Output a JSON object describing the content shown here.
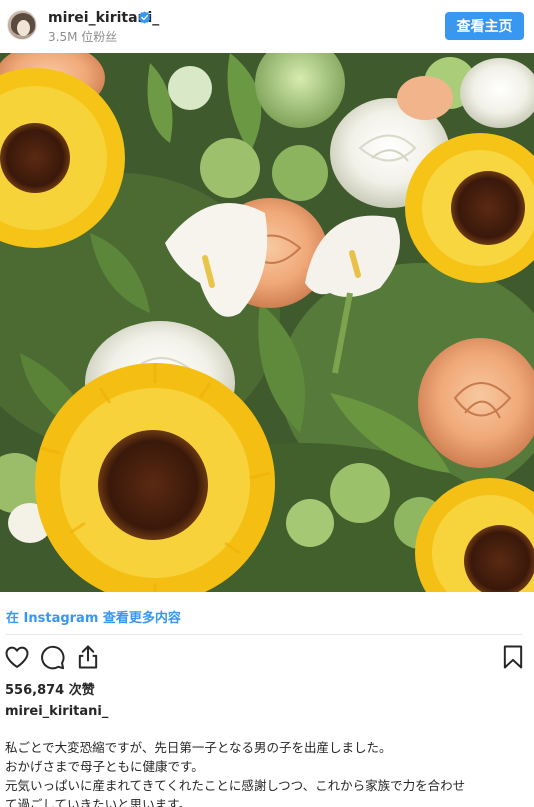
{
  "post": {
    "username": "mirei_kiritani_",
    "followers": "3.5M 位粉丝",
    "view_profile_label": "查看主页",
    "more_on_instagram": "在 Instagram 查看更多内容",
    "likes": "556,874 次赞",
    "caption_username": "mirei_kiritani_",
    "caption_lines": [
      "私ごとで大変恐縮ですが、先日第一子となる男の子を出産しました。",
      "おかげさまで母子ともに健康です。",
      "元気いっぱいに産まれてきてくれたことに感謝しつつ、これから家族で力を合わせ",
      "て過ごしていきたいと思います。"
    ]
  },
  "icons": {
    "verified": "verified-badge-icon",
    "like": "heart-icon",
    "comment": "comment-icon",
    "share": "share-icon",
    "save": "bookmark-icon"
  },
  "colors": {
    "accent": "#3897f0",
    "text": "#262626",
    "muted": "#8e8e8e"
  }
}
